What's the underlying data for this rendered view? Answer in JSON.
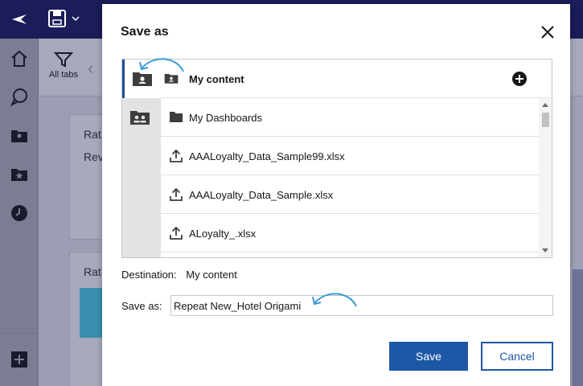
{
  "app": {
    "toolbar": {
      "filter_label": "All tabs"
    },
    "cards": [
      {
        "line1": "Rat",
        "line2": "Rev"
      },
      {
        "line1": "Rat"
      }
    ],
    "colors": {
      "topbar": "#1b1c58",
      "sidebar": "#7b7e93"
    }
  },
  "dialog": {
    "title": "Save as",
    "rail": [
      {
        "icon": "folder-user-icon",
        "active": true
      },
      {
        "icon": "folder-team-icon",
        "active": false
      }
    ],
    "header": {
      "icon": "folder-user-icon",
      "title": "My content",
      "add_icon": "plus-circle-icon"
    },
    "files": [
      {
        "icon": "folder-icon",
        "label": "My Dashboards"
      },
      {
        "icon": "upload-icon",
        "label": "AAALoyalty_Data_Sample99.xlsx"
      },
      {
        "icon": "upload-icon",
        "label": "AAALoyalty_Data_Sample.xlsx"
      },
      {
        "icon": "upload-icon",
        "label": "ALoyalty_.xlsx"
      }
    ],
    "destination": {
      "label": "Destination:",
      "value": "My content"
    },
    "save_as": {
      "label": "Save as:",
      "value": "Repeat New_Hotel Origami"
    },
    "buttons": {
      "save": "Save",
      "cancel": "Cancel"
    },
    "colors": {
      "primary": "#1d57a6",
      "annotation": "#3a9bd5"
    }
  }
}
